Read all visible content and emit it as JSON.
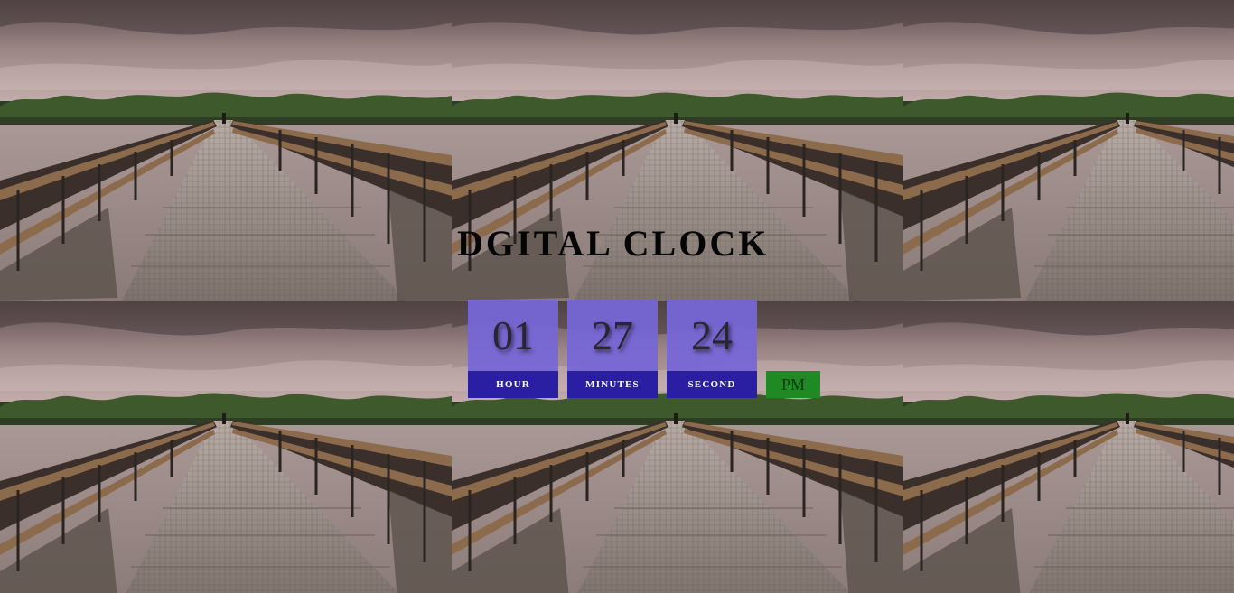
{
  "title": "DGITAL CLOCK",
  "clock": {
    "hour": "01",
    "minutes": "27",
    "second": "24",
    "period": "PM"
  },
  "labels": {
    "hour": "HOUR",
    "minutes": "MINUTES",
    "second": "SECOND"
  },
  "colors": {
    "digit_box": "#7666d7",
    "label_box": "#2a1fa3",
    "period_box": "#1f8a24"
  },
  "background": {
    "image": "bridge-over-river-photo"
  }
}
